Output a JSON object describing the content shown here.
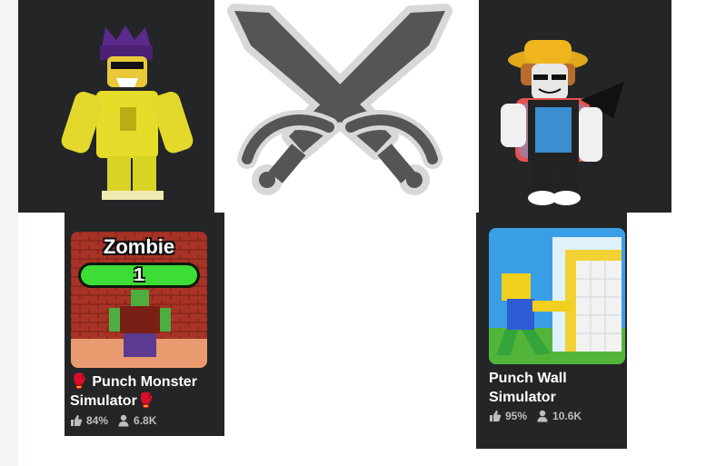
{
  "avatars": {
    "left": {
      "icon": "avatar-yellow-crown-icon"
    },
    "right": {
      "icon": "avatar-bucket-hat-icon"
    }
  },
  "battle": {
    "icon": "crossed-swords-icon"
  },
  "games": [
    {
      "title": "🥊 Punch Monster Simulator🥊",
      "thumb": {
        "banner": "Zombie",
        "level": "1"
      },
      "rating": "84%",
      "players": "6.8K"
    },
    {
      "title": "Punch Wall Simulator",
      "rating": "95%",
      "players": "10.6K"
    }
  ],
  "icons": {
    "rating": "thumbs-up-icon",
    "players": "person-icon"
  },
  "colors": {
    "card_bg": "#232527",
    "title": "#ffffff",
    "stat": "#bdbebe"
  }
}
